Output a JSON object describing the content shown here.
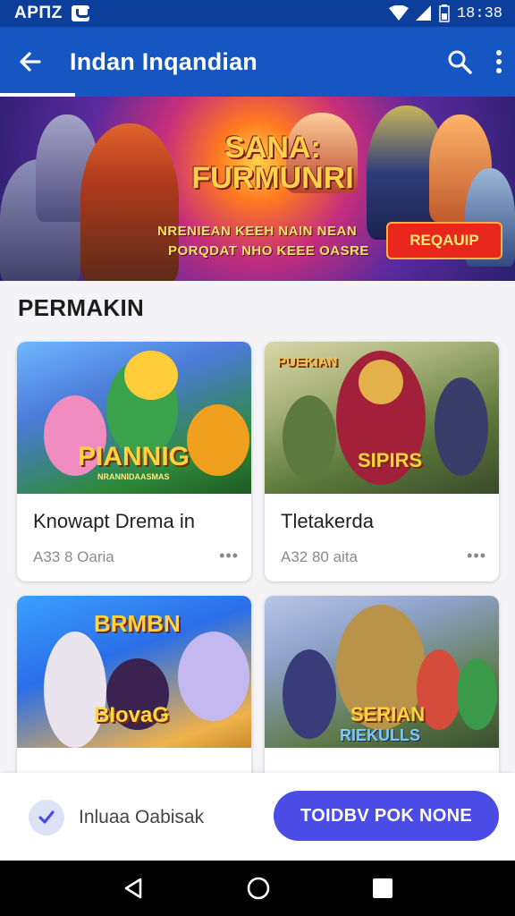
{
  "status_bar": {
    "left_time": "APΠZ",
    "right_time": "18:38"
  },
  "app_bar": {
    "title": "Indan Inqandian"
  },
  "banner": {
    "title": "SANA: FURMUNRI",
    "subtitle_line1": "NRENIEAN KEEH NAIN NEAN",
    "subtitle_line2": "PORQDAT NHO KEEE OASRE",
    "cta_label": "REQAUIP"
  },
  "section": {
    "title": "PERMAKIN"
  },
  "cards": [
    {
      "thumb_text": "PIANNIG",
      "thumb_subtext": "NRANNIDAASMAS",
      "title": "Knowapt Drema in",
      "meta": "A33 8 Oaria",
      "more": "•••"
    },
    {
      "thumb_text": "SIPIRS",
      "thumb_subtext": "PUEKIAN",
      "title": "Tletakerda",
      "meta": "A32 80 aita",
      "more": "•••"
    },
    {
      "thumb_text": "BRMBN",
      "thumb_subtext": "BIovaG",
      "title": "",
      "meta": "",
      "more": ""
    },
    {
      "thumb_text": "SERIAN",
      "thumb_subtext": "RIEKULLS",
      "title": "",
      "meta": "",
      "more": ""
    }
  ],
  "action_bar": {
    "label": "Inluaa Oabisak",
    "button_label": "TOIDBV POK NONE"
  },
  "colors": {
    "status_bar": "#0c3f9c",
    "app_bar": "#1556c2",
    "primary_button": "#4b4ce6",
    "banner_cta": "#e8261b"
  },
  "icons": {
    "back": "back-arrow-icon",
    "search": "search-icon",
    "more": "more-vert-icon",
    "check": "check-icon",
    "nav_back": "nav-back-icon",
    "nav_home": "nav-home-icon",
    "nav_recents": "nav-recents-icon"
  }
}
